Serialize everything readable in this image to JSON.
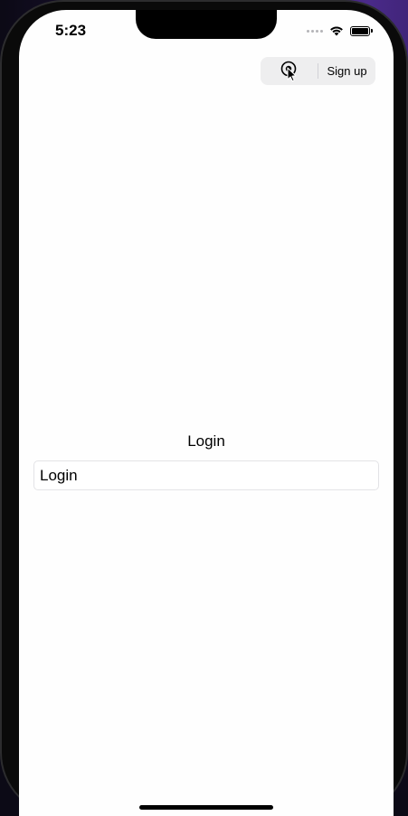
{
  "status_bar": {
    "time": "5:23"
  },
  "segmented_control": {
    "login_icon": "login-pointer-icon",
    "signup_label": "Sign up"
  },
  "main": {
    "title": "Login",
    "login_field_value": "Login"
  },
  "colors": {
    "screen_background": "#fefefe",
    "segment_background": "#eeeeef",
    "text": "#000000"
  }
}
